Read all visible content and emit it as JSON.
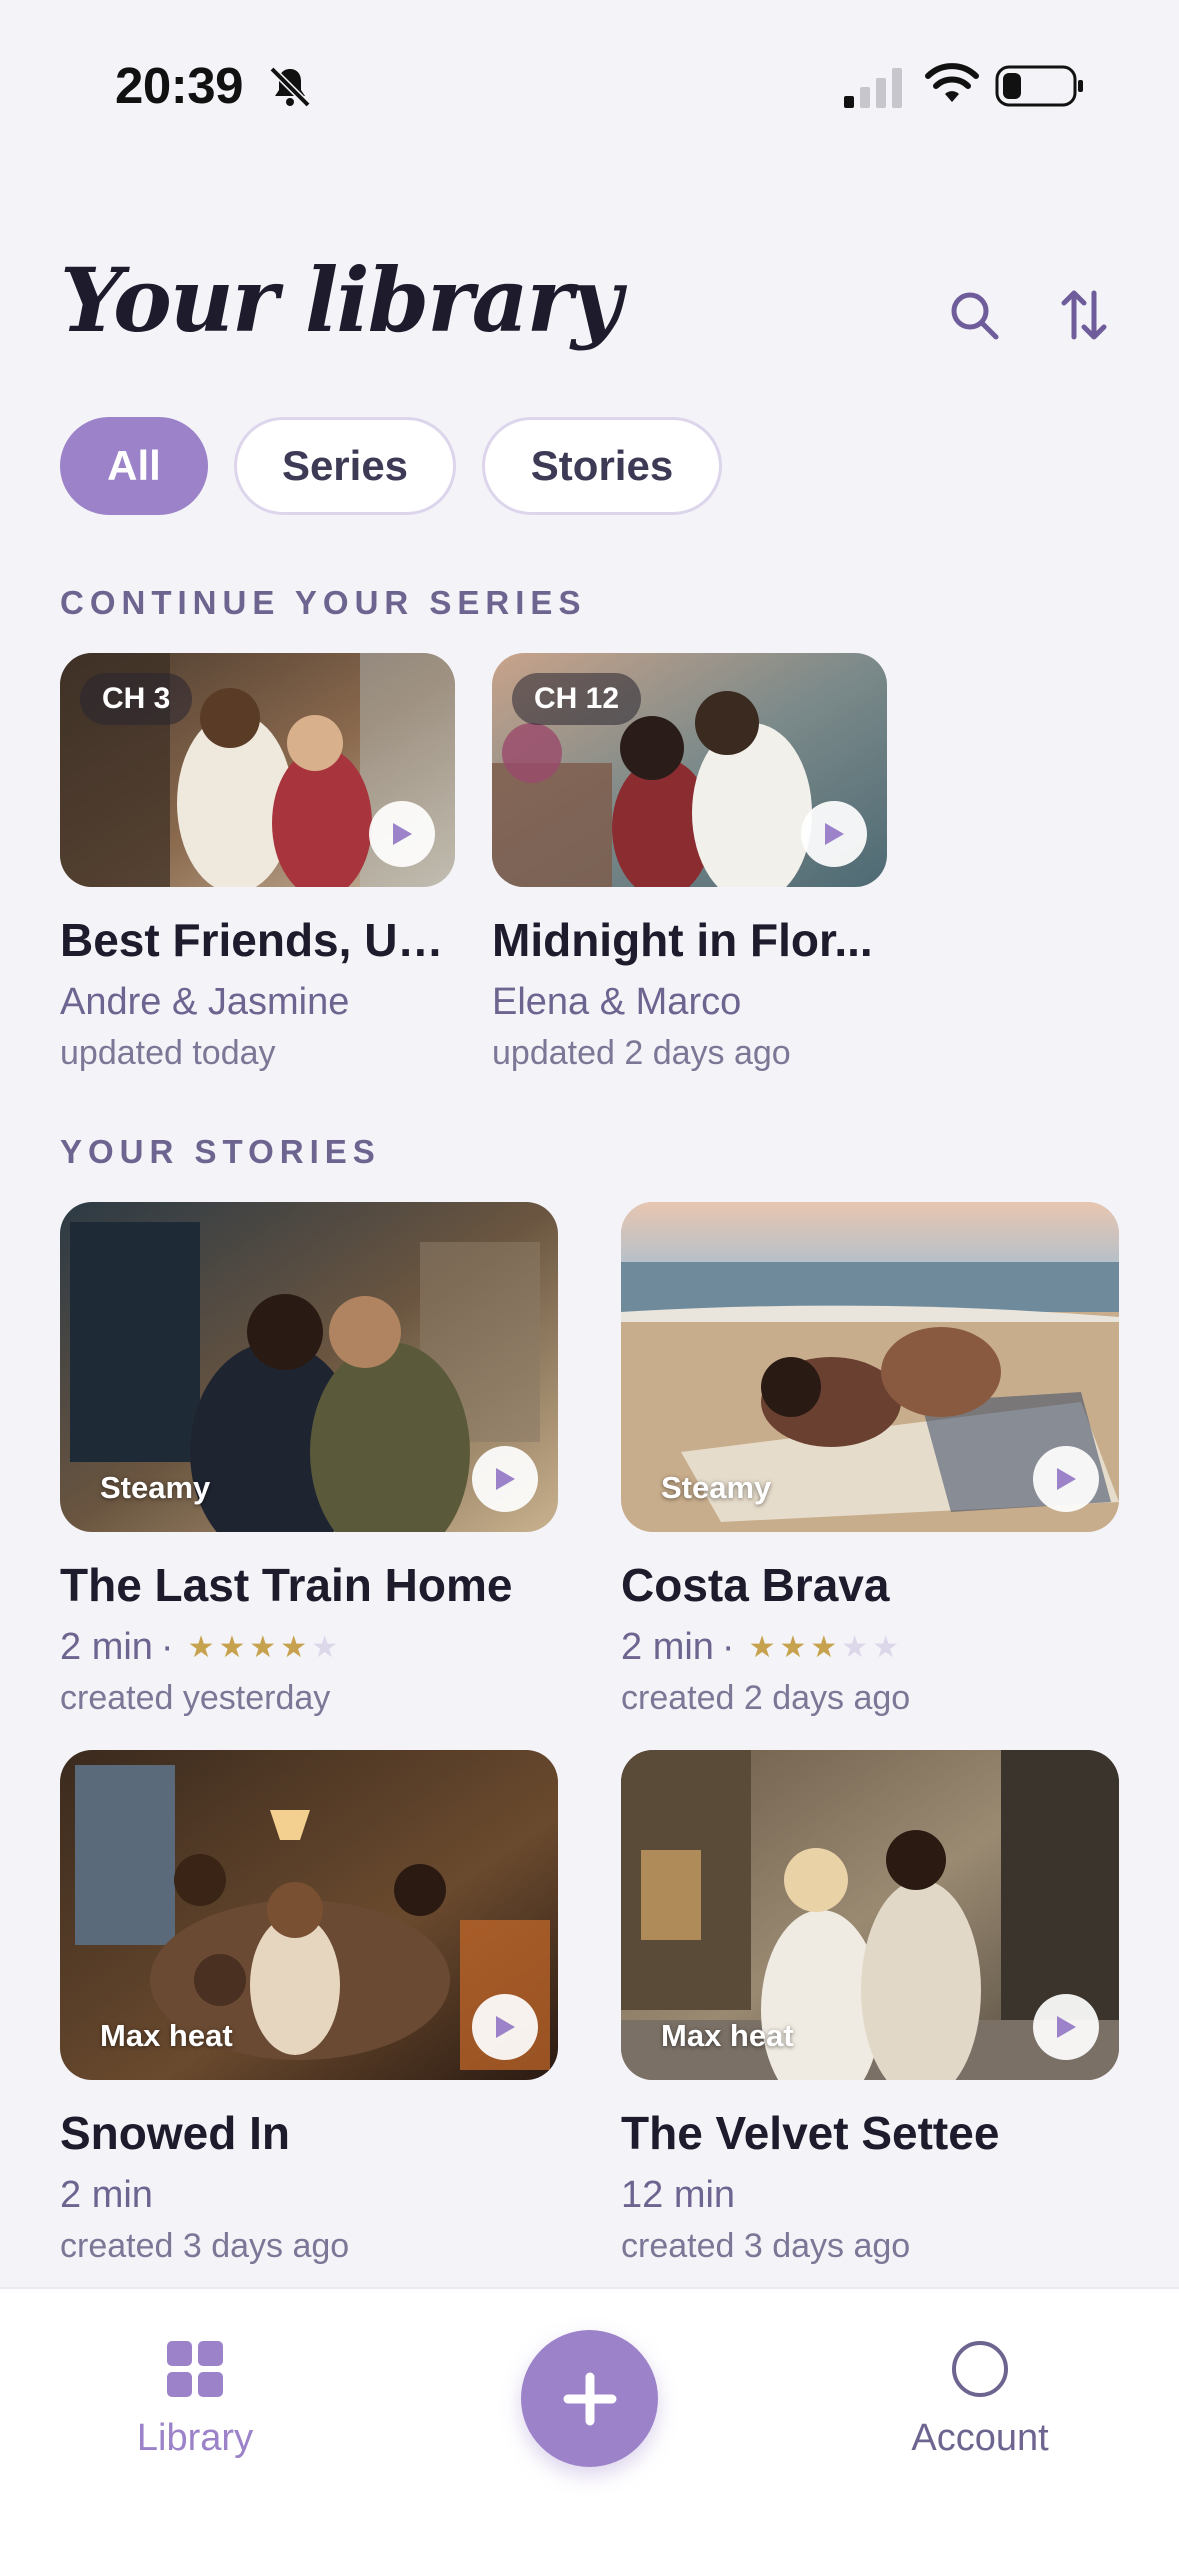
{
  "status_bar": {
    "time": "20:39"
  },
  "header": {
    "title": "Your library"
  },
  "filters": [
    {
      "label": "All",
      "active": true
    },
    {
      "label": "Series",
      "active": false
    },
    {
      "label": "Stories",
      "active": false
    }
  ],
  "continue_section": {
    "label": "CONTINUE YOUR SERIES",
    "items": [
      {
        "badge": "CH 3",
        "title": "Best Friends, Un...",
        "subtitle": "Andre & Jasmine",
        "meta": "updated today"
      },
      {
        "badge": "CH 12",
        "title": "Midnight in Flor...",
        "subtitle": "Elena & Marco",
        "meta": "updated 2 days ago"
      }
    ]
  },
  "stories_section": {
    "label": "YOUR STORIES",
    "items": [
      {
        "heat": "Steamy",
        "title": "The Last Train Home",
        "duration": "2 min",
        "rating": 4,
        "rating_max": 5,
        "meta": "created yesterday"
      },
      {
        "heat": "Steamy",
        "title": "Costa Brava",
        "duration": "2 min",
        "rating": 3,
        "rating_max": 5,
        "meta": "created 2 days ago"
      },
      {
        "heat": "Max heat",
        "title": "Snowed In",
        "duration": "2 min",
        "meta": "created 3 days ago"
      },
      {
        "heat": "Max heat",
        "title": "The Velvet Settee",
        "duration": "12 min",
        "meta": "created 3 days ago"
      }
    ]
  },
  "bottom_nav": {
    "library_label": "Library",
    "account_label": "Account"
  },
  "colors": {
    "accent": "#9b82c9",
    "background": "#f4f3f8",
    "star": "#c7a24e",
    "text_primary": "#1d1b2c",
    "text_secondary": "#6e6490"
  }
}
